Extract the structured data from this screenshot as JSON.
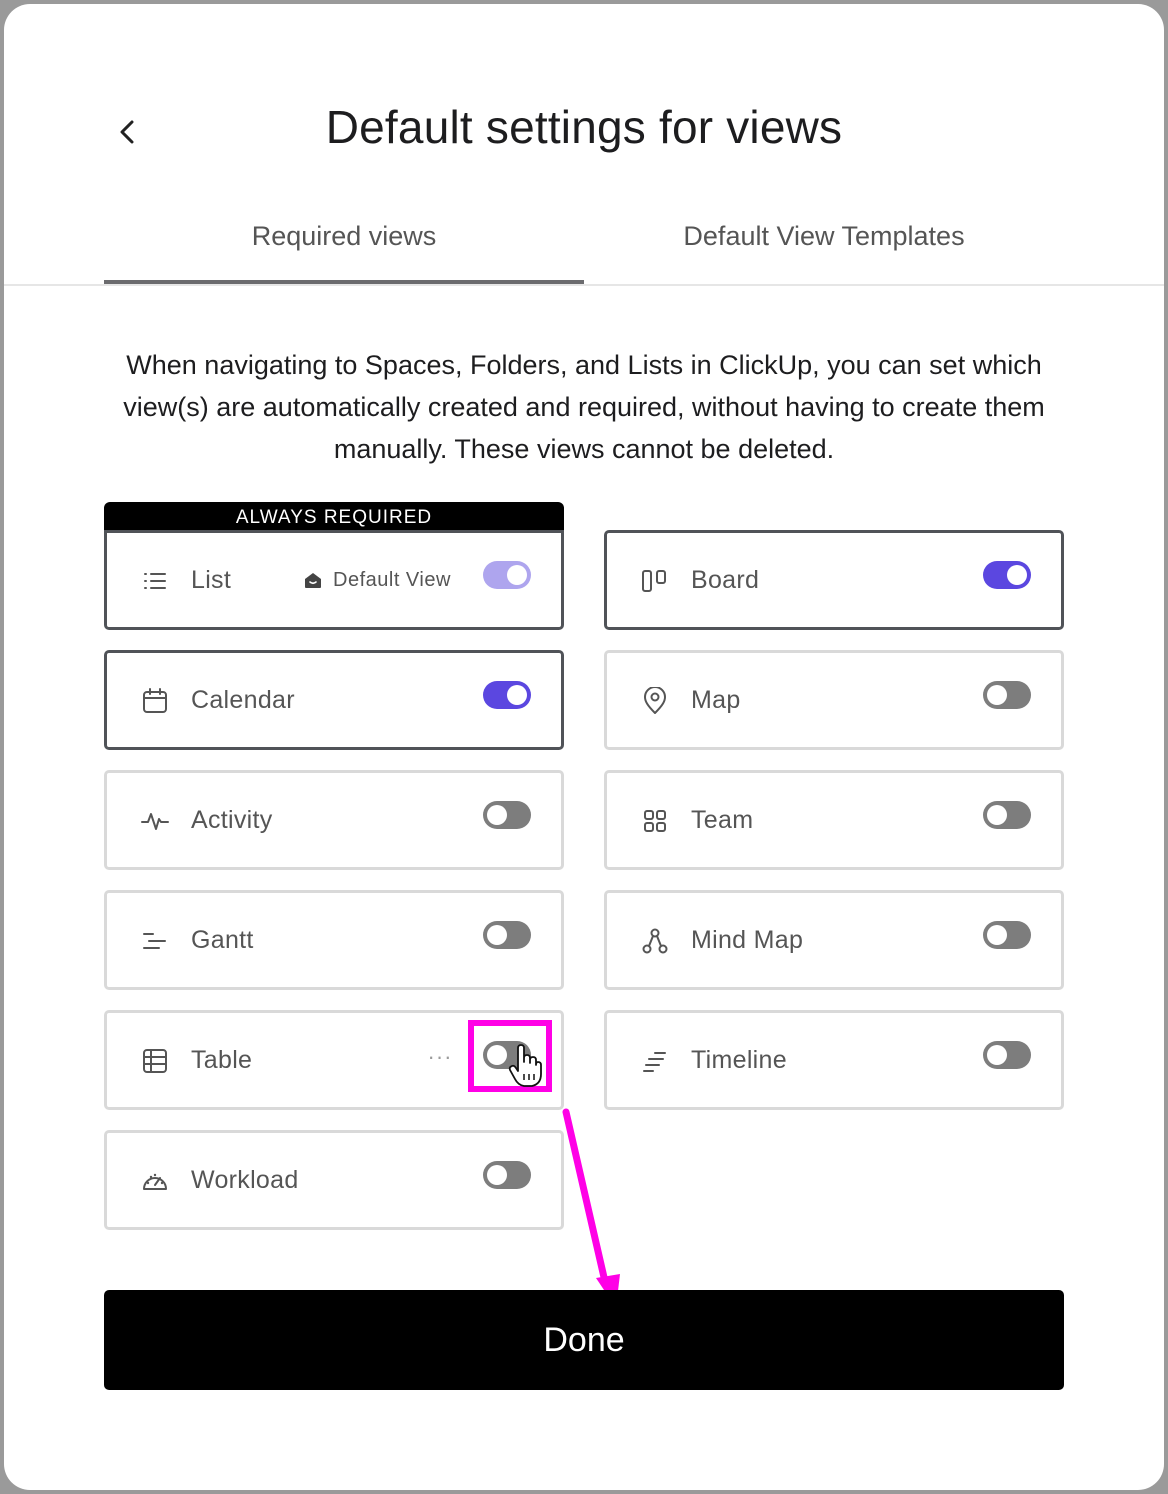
{
  "modal": {
    "title": "Default settings for views",
    "back_icon": "chevron-left-icon"
  },
  "tabs": [
    {
      "label": "Required views",
      "active": true
    },
    {
      "label": "Default View Templates",
      "active": false
    }
  ],
  "description": "When navigating to Spaces, Folders, and Lists in ClickUp, you can set which view(s) are automatically created and required, without having to create them manually. These views cannot be deleted.",
  "always_required_label": "ALWAYS REQUIRED",
  "views": [
    {
      "label": "List",
      "icon": "list-icon",
      "enabled": true,
      "locked": true,
      "default_view_label": "Default View"
    },
    {
      "label": "Board",
      "icon": "board-icon",
      "enabled": true
    },
    {
      "label": "Calendar",
      "icon": "calendar-icon",
      "enabled": true
    },
    {
      "label": "Map",
      "icon": "map-pin-icon",
      "enabled": false
    },
    {
      "label": "Activity",
      "icon": "activity-icon",
      "enabled": false
    },
    {
      "label": "Team",
      "icon": "team-grid-icon",
      "enabled": false
    },
    {
      "label": "Gantt",
      "icon": "gantt-icon",
      "enabled": false
    },
    {
      "label": "Mind Map",
      "icon": "mind-map-icon",
      "enabled": false
    },
    {
      "label": "Table",
      "icon": "table-icon",
      "enabled": false,
      "more_label": "···"
    },
    {
      "label": "Timeline",
      "icon": "timeline-icon",
      "enabled": false
    },
    {
      "label": "Workload",
      "icon": "workload-icon",
      "enabled": false
    }
  ],
  "done_label": "Done",
  "colors": {
    "toggle_on": "#5b47e0",
    "toggle_on_locked": "#aea5ee",
    "toggle_off": "#7d7d7d",
    "annotation": "#ff00e6"
  }
}
